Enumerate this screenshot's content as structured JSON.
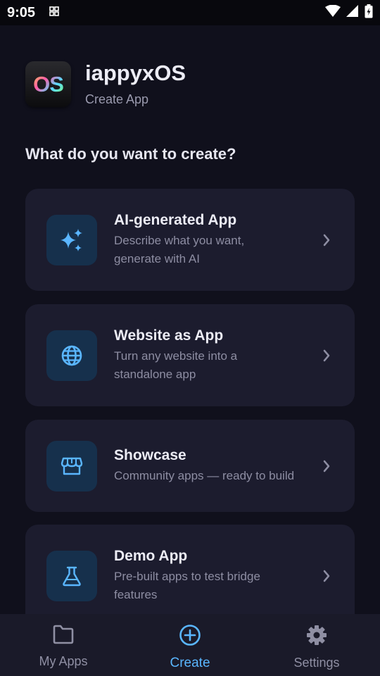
{
  "status_bar": {
    "time": "9:05"
  },
  "header": {
    "logo_text": "OS",
    "title": "iappyxOS",
    "subtitle": "Create App"
  },
  "section_title": "What do you want to create?",
  "cards": [
    {
      "title": "AI-generated App",
      "desc_line1": "Describe what you want,",
      "desc_line2": "generate with AI",
      "icon": "sparkle-icon"
    },
    {
      "title": "Website as App",
      "desc_line1": "Turn any website into a",
      "desc_line2": "standalone app",
      "icon": "globe-icon"
    },
    {
      "title": "Showcase",
      "desc_line1": "Community apps — ready to build",
      "desc_line2": "",
      "icon": "storefront-icon"
    },
    {
      "title": "Demo App",
      "desc_line1": "Pre-built apps to test bridge",
      "desc_line2": "features",
      "icon": "flask-icon"
    }
  ],
  "bottom_nav": [
    {
      "label": "My Apps",
      "icon": "folder-icon",
      "active": false
    },
    {
      "label": "Create",
      "icon": "add-circle-icon",
      "active": true
    },
    {
      "label": "Settings",
      "icon": "gear-icon",
      "active": false
    }
  ],
  "colors": {
    "background": "#10101c",
    "card": "#1c1c2e",
    "accent": "#5ab6ff",
    "icon_tile": "#16304c"
  }
}
